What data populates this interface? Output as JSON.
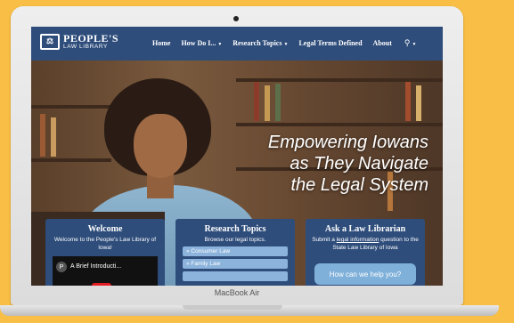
{
  "device": {
    "label": "MacBook Air"
  },
  "header": {
    "logo_mark": "⚖",
    "logo_line1": "PEOPLE'S",
    "logo_line2": "LAW LIBRARY",
    "nav": [
      {
        "label": "Home",
        "has_caret": false
      },
      {
        "label": "How Do I...",
        "has_caret": true
      },
      {
        "label": "Research Topics",
        "has_caret": true
      },
      {
        "label": "Legal Terms Defined",
        "has_caret": false
      },
      {
        "label": "About",
        "has_caret": false
      }
    ],
    "search_icon": "search-icon"
  },
  "hero": {
    "line1": "Empowering Iowans",
    "line2": "as They Navigate",
    "line3": "the Legal System"
  },
  "cards": {
    "welcome": {
      "title": "Welcome",
      "text": "Welcome to the People's Law Library of Iowa!",
      "video_avatar": "P",
      "video_title": "A Brief Introducti..."
    },
    "research": {
      "title": "Research Topics",
      "text": "Browse our legal topics.",
      "topics": [
        "» Consumer Law",
        "» Family Law"
      ]
    },
    "ask": {
      "title": "Ask a Law Librarian",
      "text_pre": "Submit a ",
      "text_link": "legal information",
      "text_post": " question to the State Law Library of Iowa",
      "placeholder": "How can we help you?"
    }
  },
  "colors": {
    "background": "#f8be45",
    "brand": "#2e4d7b",
    "topic_button": "#8bb3db"
  }
}
